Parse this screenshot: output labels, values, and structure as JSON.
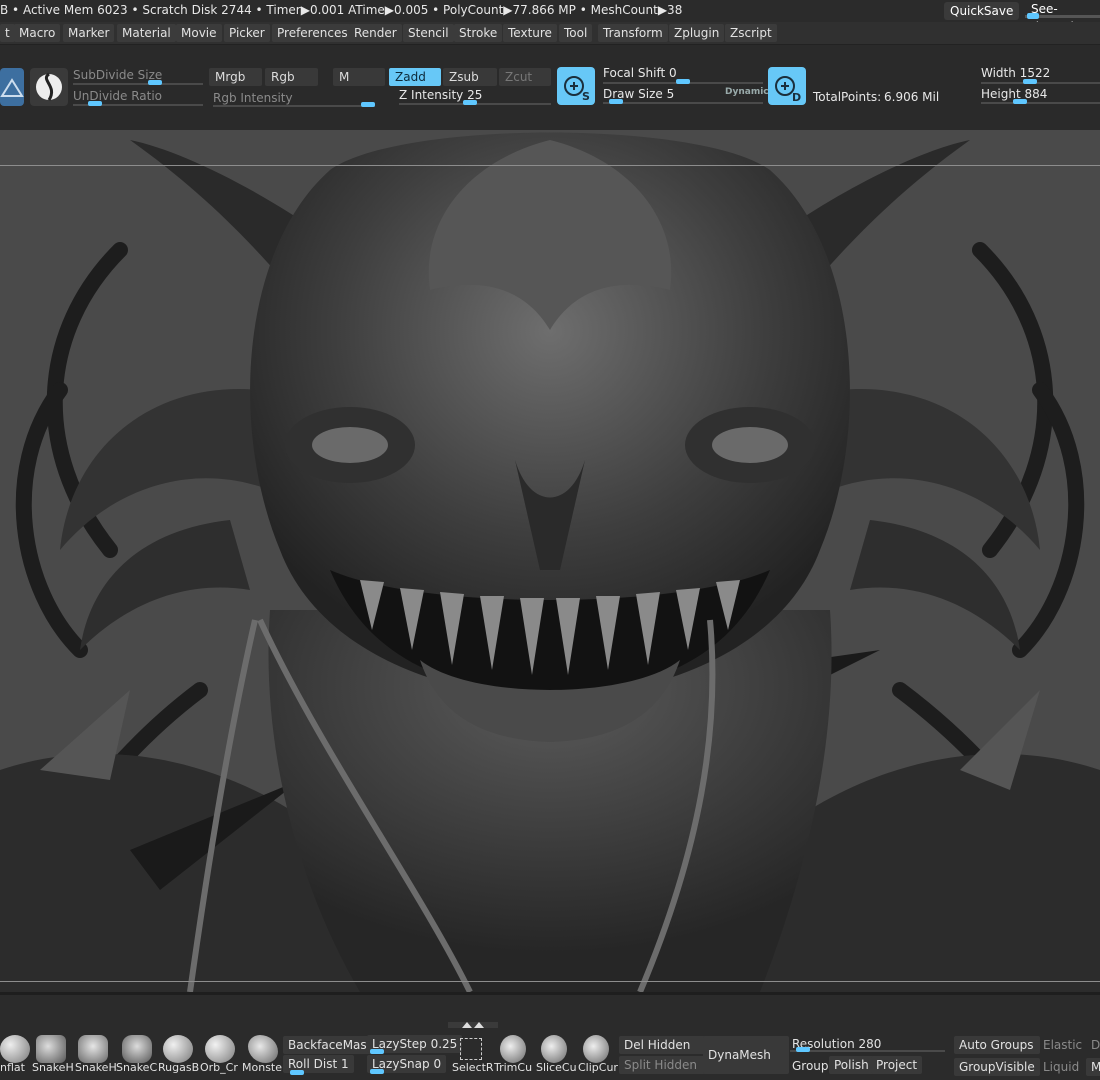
{
  "status": {
    "line": "B • Active Mem 6023 • Scratch Disk 2744 • Timer▶0.001 ATime▶0.005 • PolyCount▶77.866 MP • MeshCount▶38",
    "quicksave": "QuickSave",
    "seethrough": "See-through"
  },
  "menu": [
    "t",
    "Macro",
    "Marker",
    "Material",
    "Movie",
    "Picker",
    "Preferences",
    "Render",
    "Stencil",
    "Stroke",
    "Texture",
    "Tool",
    "Transform",
    "Zplugin",
    "Zscript"
  ],
  "toolbar": {
    "subdivide_size": "SubDivide Size",
    "undivide_ratio": "UnDivide Ratio",
    "mrgb": "Mrgb",
    "rgb": "Rgb",
    "m": "M",
    "rgb_intensity": "Rgb Intensity",
    "zadd": "Zadd",
    "zsub": "Zsub",
    "zcut": "Zcut",
    "z_intensity": "Z Intensity 25",
    "focal_shift": "Focal Shift 0",
    "draw_size": "Draw Size 5",
    "dynamic": "Dynamic",
    "s_badge": "S",
    "d_badge": "D",
    "total_points_label": "TotalPoints:",
    "total_points_value": "6.906 Mil",
    "width": "Width 1522",
    "height": "Height 884"
  },
  "brushes": [
    "nflat",
    "SnakeH",
    "SnakeH",
    "SnakeC",
    "RugasB",
    "Orb_Cr",
    "Monste",
    "SelectR",
    "TrimCu",
    "SliceCu",
    "ClipCur"
  ],
  "bottom": {
    "backface": "BackfaceMask",
    "roll_dist": "Roll Dist 1",
    "lazy_step": "LazyStep 0.25",
    "lazy_snap": "LazySnap 0",
    "del_hidden": "Del Hidden",
    "split_hidden": "Split Hidden",
    "dynamesh": "DynaMesh",
    "resolution": "Resolution 280",
    "group": "Group:",
    "polish": "Polish",
    "project": "Project",
    "auto_groups": "Auto Groups",
    "group_visible": "GroupVisible",
    "elastic": "Elastic",
    "liquid": "Liquid",
    "d_trunc": "D",
    "m_trunc": "M"
  },
  "colors": {
    "accent": "#5fc7ff",
    "active_field": "#67c8f7",
    "viewport": "#4a4a4a"
  }
}
